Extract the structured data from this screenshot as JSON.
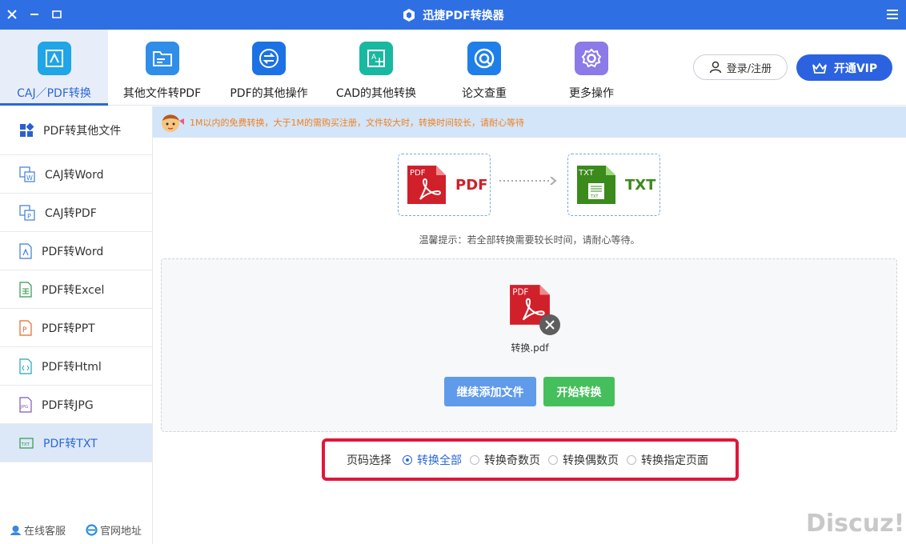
{
  "titlebar": {
    "title": "迅捷PDF转换器",
    "close_icon": "close-icon",
    "minimize_icon": "minimize-icon",
    "maximize_icon": "maximize-icon",
    "menu_icon": "menu-icon"
  },
  "toolbar": {
    "tools": [
      {
        "label": "CAJ／PDF转换",
        "icon": "caj-pdf-icon",
        "color": "#1fa5e8",
        "active": true
      },
      {
        "label": "其他文件转PDF",
        "icon": "folder-icon",
        "color": "#2e8ee8"
      },
      {
        "label": "PDF的其他操作",
        "icon": "exchange-icon",
        "color": "#1c72e4"
      },
      {
        "label": "CAD的其他转换",
        "icon": "cad-icon",
        "color": "#19b8a0"
      },
      {
        "label": "论文查重",
        "icon": "check-icon",
        "color": "#1f7fe8"
      },
      {
        "label": "更多操作",
        "icon": "gear-icon",
        "color": "#8b7ae8"
      }
    ],
    "login_label": "登录/注册",
    "vip_label": "开通VIP"
  },
  "sidebar": {
    "items": [
      {
        "label": "PDF转其他文件",
        "icon": "grid-icon"
      },
      {
        "label": "CAJ转Word",
        "icon": "caj-word-icon"
      },
      {
        "label": "CAJ转PDF",
        "icon": "caj-pdf-file-icon"
      },
      {
        "label": "PDF转Word",
        "icon": "pdf-word-icon"
      },
      {
        "label": "PDF转Excel",
        "icon": "pdf-excel-icon"
      },
      {
        "label": "PDF转PPT",
        "icon": "pdf-ppt-icon"
      },
      {
        "label": "PDF转Html",
        "icon": "pdf-html-icon"
      },
      {
        "label": "PDF转JPG",
        "icon": "pdf-jpg-icon"
      },
      {
        "label": "PDF转TXT",
        "icon": "pdf-txt-icon",
        "active": true
      }
    ],
    "footer": {
      "service_label": "在线客服",
      "website_label": "官网地址"
    }
  },
  "notice": {
    "text": "1M以内的免费转换，大于1M的需购买注册，文件较大时，转换时间较长，请耐心等待"
  },
  "conversion": {
    "from_badge": "PDF",
    "from_label": "PDF",
    "to_badge": "TXT",
    "to_label": "TXT",
    "from_color": "#d0202a",
    "to_color": "#3a8a1c"
  },
  "tip": "温馨提示：若全部转换需要较长时间，请耐心等待。",
  "dropzone": {
    "file_badge": "PDF",
    "file_name": "转换.pdf",
    "add_button": "继续添加文件",
    "start_button": "开始转换"
  },
  "page_select": {
    "label": "页码选择",
    "options": [
      {
        "label": "转换全部",
        "selected": true
      },
      {
        "label": "转换奇数页"
      },
      {
        "label": "转换偶数页"
      },
      {
        "label": "转换指定页面"
      }
    ]
  },
  "watermark": "Discuz!"
}
